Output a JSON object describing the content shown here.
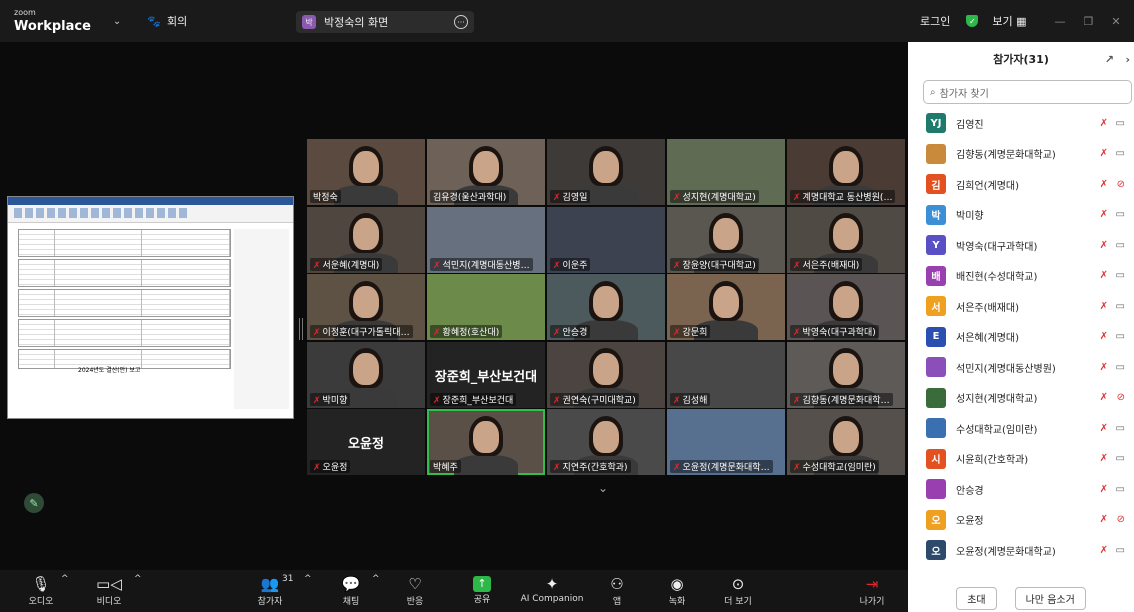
{
  "app": {
    "brand_small": "zoom",
    "brand_main": "Workplace",
    "meeting_label": "회의"
  },
  "share": {
    "initial": "박",
    "label": "박정숙의 화면"
  },
  "topbar_right": {
    "login": "로그인",
    "view": "보기"
  },
  "shared_doc": {
    "title": "2024년도 결산(안) 보고"
  },
  "grid": {
    "tiles": [
      {
        "label": "박정숙",
        "mic_off": false
      },
      {
        "label": "김유경(울산과학대)",
        "mic_off": false
      },
      {
        "label": "김영일",
        "mic_off": true
      },
      {
        "label": "성지현(계명대학교)",
        "mic_off": true
      },
      {
        "label": "계명대학교 동산병원(…",
        "mic_off": true
      },
      {
        "label": "서운혜(계명대)",
        "mic_off": true
      },
      {
        "label": "석민지(계명대동산병…",
        "mic_off": true
      },
      {
        "label": "이운주",
        "mic_off": true
      },
      {
        "label": "장윤양(대구대학교)",
        "mic_off": true
      },
      {
        "label": "서은주(배재대)",
        "mic_off": true
      },
      {
        "label": "이정훈(대구가톨릭대…",
        "mic_off": true
      },
      {
        "label": "황혜정(호산대)",
        "mic_off": true
      },
      {
        "label": "안승경",
        "mic_off": true
      },
      {
        "label": "강문희",
        "mic_off": true
      },
      {
        "label": "박영숙(대구과학대)",
        "mic_off": true
      },
      {
        "label": "박미향",
        "mic_off": true
      },
      {
        "label": "장준희_부산보건대",
        "mic_off": true,
        "big": "장준희_부산보건대"
      },
      {
        "label": "권연숙(구미대학교)",
        "mic_off": true
      },
      {
        "label": "김성해",
        "mic_off": true
      },
      {
        "label": "김향동(계명문화대학…",
        "mic_off": true
      },
      {
        "label": "오윤정",
        "mic_off": true,
        "big": "오윤정"
      },
      {
        "label": "박혜주",
        "mic_off": false
      },
      {
        "label": "지연주(간호학과)",
        "mic_off": true
      },
      {
        "label": "오윤정(계명문화대학…",
        "mic_off": true
      },
      {
        "label": "수성대학교(임미란)",
        "mic_off": true
      }
    ]
  },
  "toolbar": {
    "audio": "오디오",
    "video": "비디오",
    "participants": "참가자",
    "participants_count": "31",
    "chat": "채팅",
    "reactions": "반응",
    "share": "공유",
    "ai": "AI Companion",
    "apps": "앱",
    "record": "녹화",
    "more": "더 보기",
    "leave": "나가기"
  },
  "panel": {
    "title": "참가자(31)",
    "search_placeholder": "참가자 찾기",
    "invite": "초대",
    "mute_all": "나만 음소거",
    "participants": [
      {
        "initials": "YJ",
        "name": "김영진",
        "color": "#1f7a6e",
        "cam_off": false
      },
      {
        "initials": "",
        "name": "김향동(계명문화대학교)",
        "color": "#c98a3c",
        "cam_off": false
      },
      {
        "initials": "김",
        "name": "김희언(계명대)",
        "color": "#e2511f",
        "cam_off": true
      },
      {
        "initials": "박",
        "name": "박미향",
        "color": "#3a8fd6",
        "cam_off": false
      },
      {
        "initials": "Y",
        "name": "박영숙(대구과학대)",
        "color": "#5a4fc4",
        "cam_off": false
      },
      {
        "initials": "배",
        "name": "배진현(수성대학교)",
        "color": "#9a3fb0",
        "cam_off": false
      },
      {
        "initials": "서",
        "name": "서은주(배재대)",
        "color": "#f0a020",
        "cam_off": false
      },
      {
        "initials": "E",
        "name": "서은혜(계명대)",
        "color": "#2a4fb0",
        "cam_off": false
      },
      {
        "initials": "",
        "name": "석민지(계명대동산병원)",
        "color": "#8a4fb8",
        "cam_off": false
      },
      {
        "initials": "",
        "name": "성지현(계명대학교)",
        "color": "#3a6b3a",
        "cam_off": true
      },
      {
        "initials": "",
        "name": "수성대학교(임미란)",
        "color": "#3a6fb0",
        "cam_off": false
      },
      {
        "initials": "시",
        "name": "시윤희(간호학과)",
        "color": "#e2511f",
        "cam_off": false
      },
      {
        "initials": "",
        "name": "안승경",
        "color": "#9a3fb0",
        "cam_off": false
      },
      {
        "initials": "오",
        "name": "오윤정",
        "color": "#f0a020",
        "cam_off": true
      },
      {
        "initials": "오",
        "name": "오윤정(계명문화대학교)",
        "color": "#2e4a6a",
        "cam_off": false
      }
    ]
  }
}
